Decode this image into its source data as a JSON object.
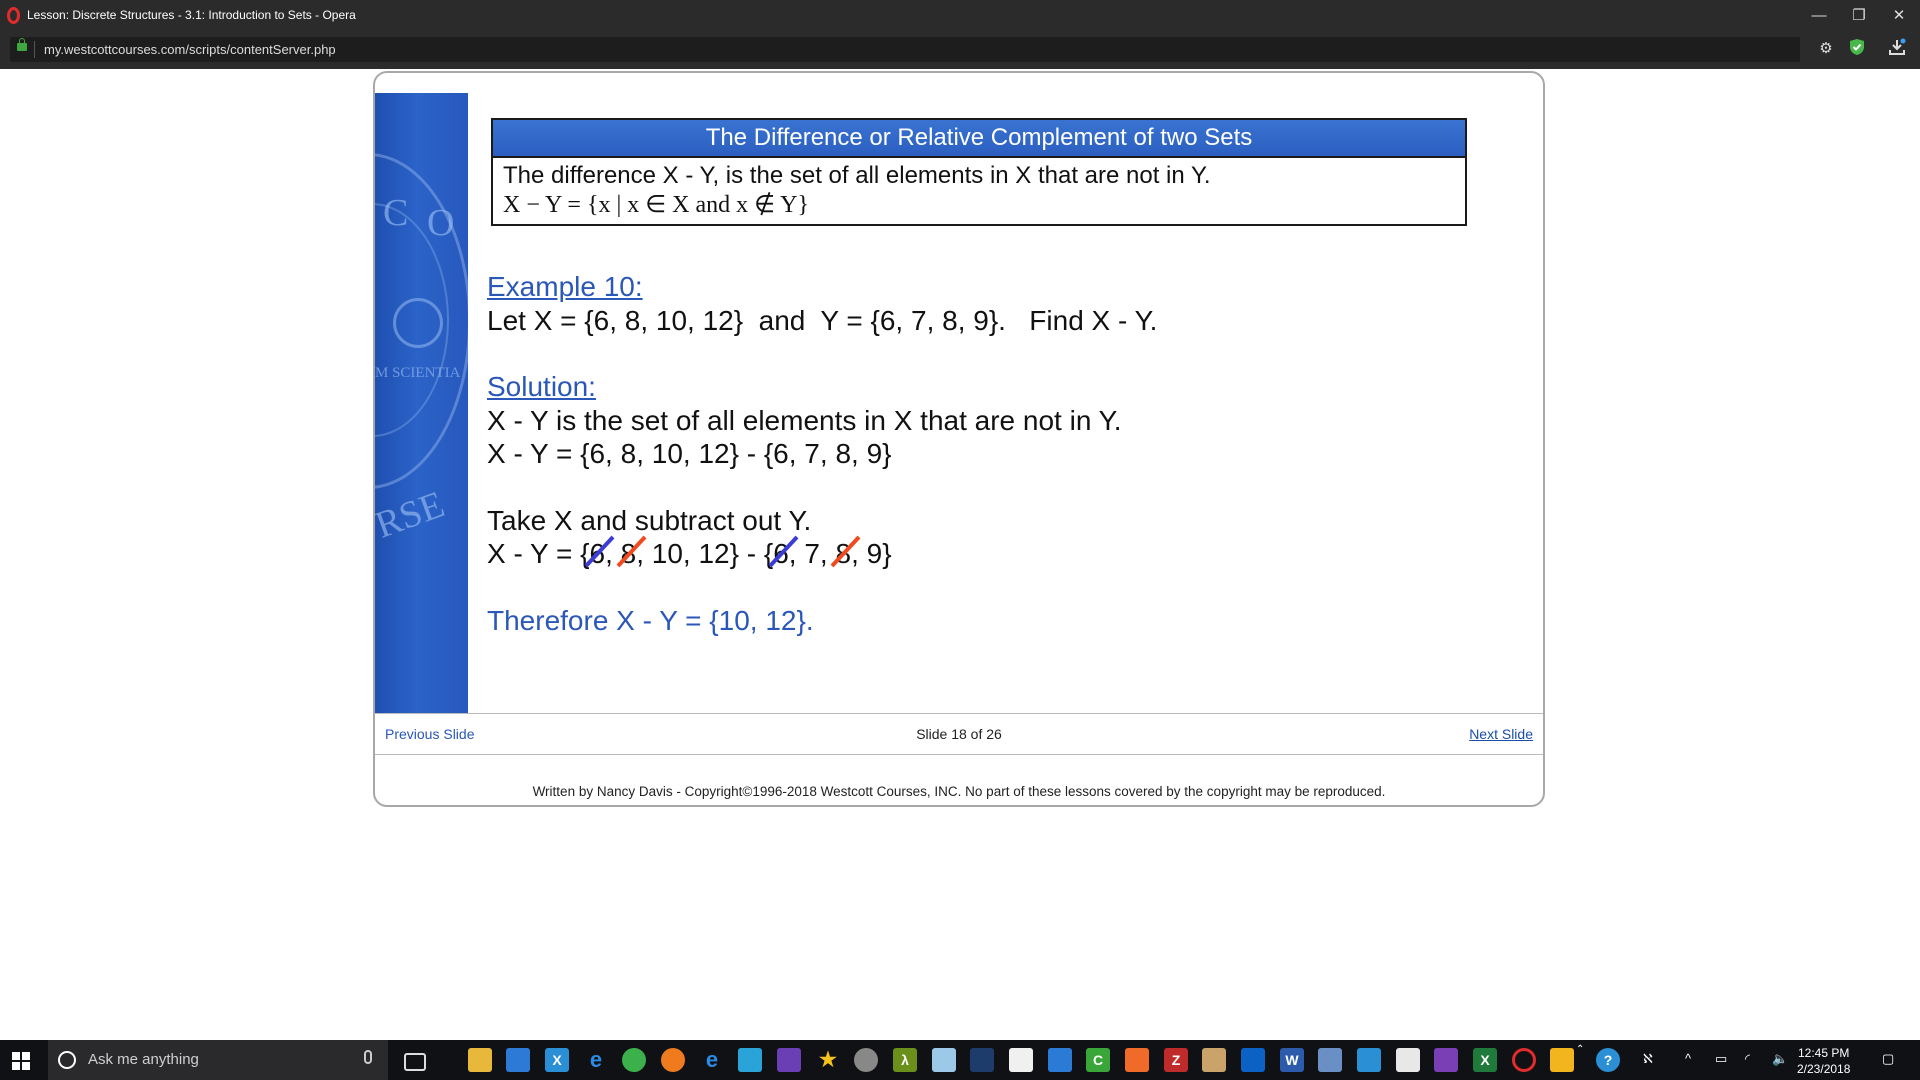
{
  "window": {
    "title": "Lesson: Discrete Structures - 3.1: Introduction to Sets - Opera",
    "minimize": "—",
    "restore": "❐",
    "close": "✕"
  },
  "address_bar": {
    "url": "my.westcottcourses.com/scripts/contentServer.php"
  },
  "slide": {
    "definition": {
      "header": "The Difference or Relative Complement of two Sets",
      "text": "The difference X - Y, is the set of all elements in X that are not in Y.",
      "formula": "X − Y = {x | x ∈ X  and  x ∉ Y}"
    },
    "example": {
      "heading": "Example 10:",
      "problem": "Let X = {6, 8, 10, 12}  and  Y = {6, 7, 8, 9}.   Find X - Y."
    },
    "solution": {
      "heading": "Solution:",
      "line1": "X - Y is the set of all elements in X that are not in Y.",
      "line2": "X - Y = {6, 8, 10, 12} - {6, 7, 8, 9}",
      "line3": "Take X and subtract out Y.",
      "line4_prefix": "X - Y = {",
      "line4_x_struck_1": "6",
      "line4_x_struck_2": "8",
      "line4_middle": ", 10, 12} - {",
      "line4_y_struck_1": "6",
      "line4_y_7": ", 7, ",
      "line4_y_struck_2": "8",
      "line4_suffix": ", 9}",
      "strike_colors": {
        "six": "#3b3bd6",
        "eight": "#f04a1e"
      },
      "conclusion": "Therefore X - Y = {10, 12}."
    },
    "nav": {
      "previous": "Previous Slide",
      "counter": "Slide 18 of 26",
      "next": "Next Slide"
    },
    "copyright": "Written by Nancy Davis - Copyright©1996-2018 Westcott Courses, INC. No part of these lessons covered by the copyright may be reproduced.",
    "sidebar_seal": {
      "letter_c": "C",
      "letter_o": "O",
      "scientia": "M SCIENTIA",
      "rse": "RSE"
    }
  },
  "taskbar": {
    "search_placeholder": "Ask me anything",
    "clock_time": "12:45 PM",
    "clock_date": "2/23/2018"
  }
}
